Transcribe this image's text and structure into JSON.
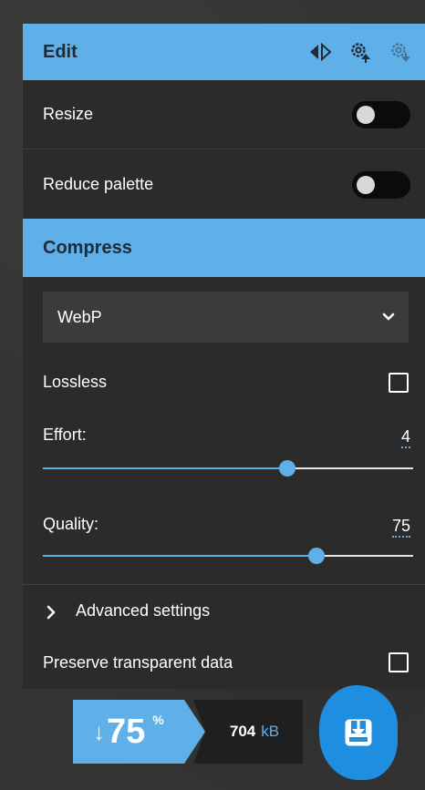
{
  "colors": {
    "accent": "#5fb0e8",
    "accent_strong": "#1e8fe0",
    "panel_bg": "#2b2b2b",
    "page_bg": "#343434",
    "text": "#ffffff"
  },
  "edit": {
    "title": "Edit",
    "icons": [
      "compare-arrows-icon",
      "settings-upload-icon",
      "settings-download-icon"
    ],
    "resize": {
      "label": "Resize",
      "enabled": false
    },
    "reduce_palette": {
      "label": "Reduce palette",
      "enabled": false
    }
  },
  "compress": {
    "title": "Compress",
    "format": {
      "selected": "WebP"
    },
    "lossless": {
      "label": "Lossless",
      "checked": false
    },
    "effort": {
      "label": "Effort:",
      "value": "4",
      "fraction": 0.66
    },
    "quality": {
      "label": "Quality:",
      "value": "75",
      "fraction": 0.74
    },
    "advanced": {
      "label": "Advanced settings",
      "expanded": false
    },
    "preserve": {
      "label": "Preserve transparent data",
      "checked": false
    }
  },
  "result": {
    "arrow": "↓",
    "percent": "75",
    "percent_sign": "%",
    "size_value": "704",
    "size_unit": "kB",
    "download_icon": "download-icon"
  }
}
